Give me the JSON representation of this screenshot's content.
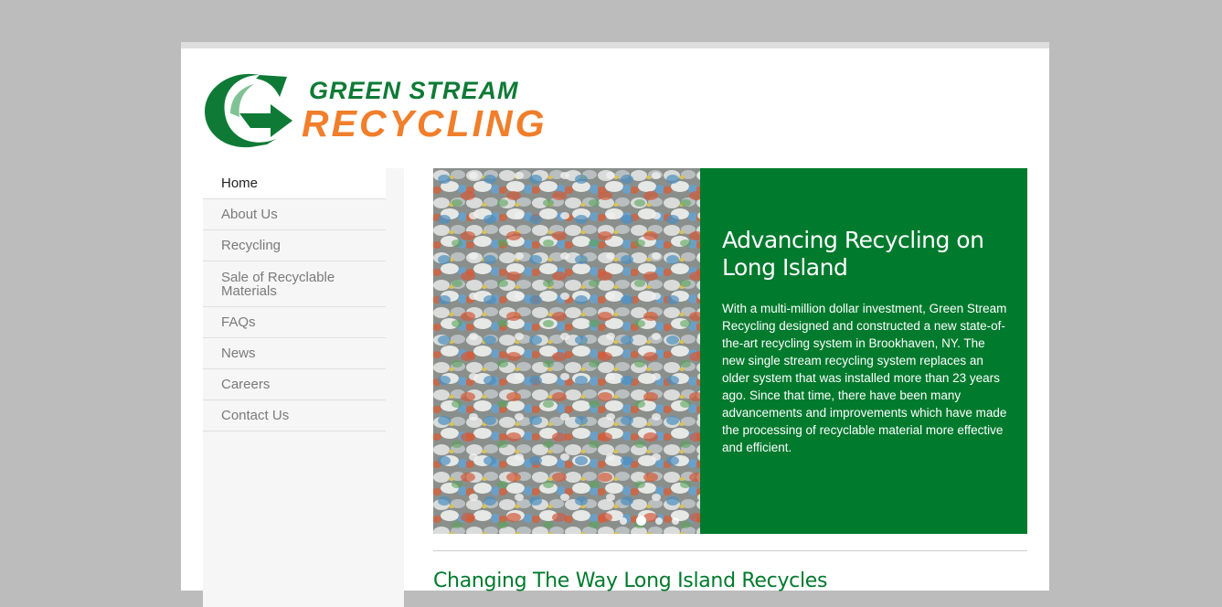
{
  "brand": {
    "line1": "GREEN STREAM",
    "line2": "RECYCLING",
    "colors": {
      "green": "#0e7a36",
      "orange": "#f07e2b"
    }
  },
  "nav": {
    "items": [
      {
        "label": "Home",
        "active": true
      },
      {
        "label": "About Us"
      },
      {
        "label": "Recycling"
      },
      {
        "label": "Sale of Recyclable Materials"
      },
      {
        "label": "FAQs"
      },
      {
        "label": "News"
      },
      {
        "label": "Careers"
      },
      {
        "label": "Contact Us"
      }
    ]
  },
  "slider": {
    "title": "Advancing Recycling on Long Island",
    "text": "With a multi-million dollar investment, Green Stream Recycling designed and constructed a new state-of-the-art recycling system in Brookhaven, NY.  The new single stream recycling system replaces an older system that was installed more than 23 years ago.  Since that time, there have been many advancements and improvements which have made the processing of recyclable material more effective and efficient.",
    "dots_count": 4,
    "active_dot": 2,
    "background_color": "#007a2d"
  },
  "main": {
    "section_title": "Changing The Way Long Island Recycles"
  }
}
